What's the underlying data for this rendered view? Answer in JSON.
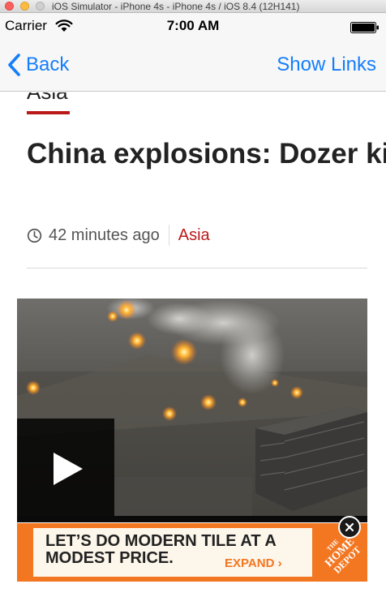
{
  "simulator": {
    "title": "iOS Simulator - iPhone 4s - iPhone 4s / iOS 8.4 (12H141)"
  },
  "status_bar": {
    "carrier": "Carrier",
    "time": "7:00 AM",
    "icons": [
      "wifi-icon",
      "battery-icon"
    ]
  },
  "nav": {
    "back_label": "Back",
    "right_label": "Show Links",
    "tint_color": "#147efb"
  },
  "article": {
    "section_tag": "Asia",
    "headline": "China explosions: Dozer killed in Tianjin port blas",
    "time_ago": "42 minutes ago",
    "section": "Asia",
    "accent_color": "#bb1919"
  },
  "video": {
    "icon": "play-icon"
  },
  "ad": {
    "headline": "LET’S DO MODERN TILE AT A\nMODEST PRICE.",
    "expand_label": "EXPAND ›",
    "logo_text": "THE HOME DEPOT",
    "brand_color": "#f37621"
  }
}
